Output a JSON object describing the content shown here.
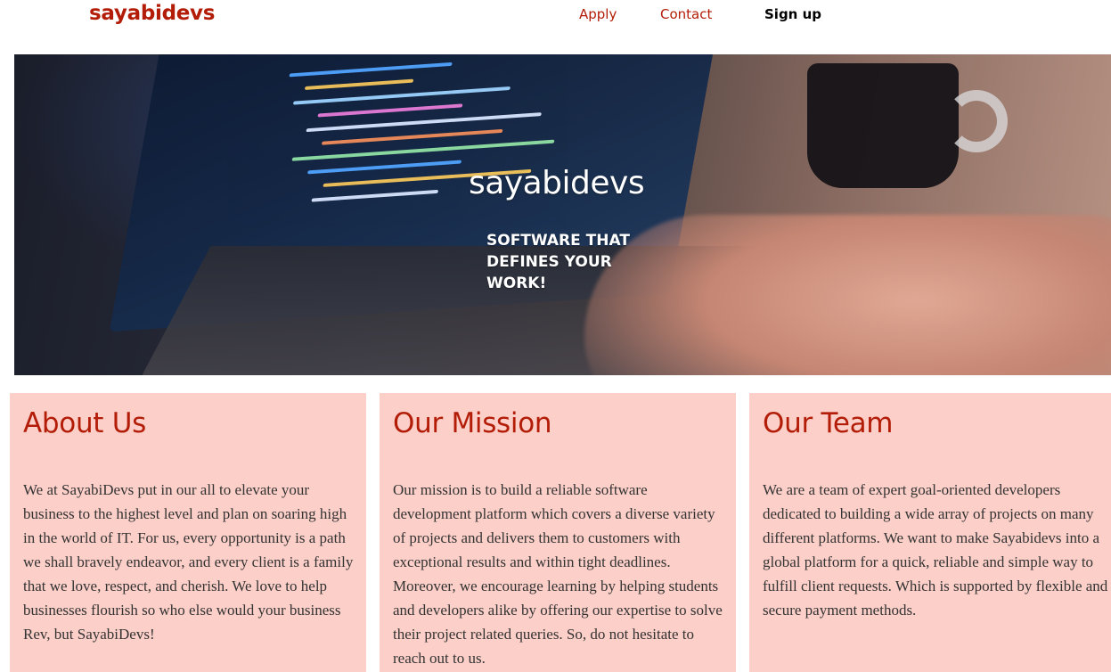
{
  "header": {
    "logo": "sayabidevs",
    "nav": {
      "apply": "Apply",
      "contact": "Contact",
      "signup": "Sign up"
    }
  },
  "hero": {
    "title": "sayabidevs",
    "tagline": "SOFTWARE THAT DEFINES YOUR WORK!",
    "image": "laptop-coding-photo"
  },
  "cards": [
    {
      "title": "About Us",
      "body": "We at SayabiDevs put in our all to elevate your business to the highest level and plan on soaring high in the world of IT. For us, every opportunity is a path we shall bravely endeavor, and every client is a family that we love, respect, and cherish. We love to help businesses flourish so who else would your business Rev, but SayabiDevs!"
    },
    {
      "title": "Our Mission",
      "body": "Our mission is to build a reliable software development platform which covers a diverse variety of projects and delivers them to customers with exceptional results and within tight deadlines. Moreover, we encourage learning by helping students and developers alike by offering our expertise to solve their project related queries. So, do not hesitate to reach out to us."
    },
    {
      "title": "Our Team",
      "body": "We are a team of expert goal-oriented developers dedicated to building a wide array of projects on many different platforms. We want to make Sayabidevs into a global platform for a quick, reliable and simple way to fulfill client requests. Which is supported by flexible and secure payment methods."
    }
  ],
  "colors": {
    "brand": "#b31d08",
    "card_background": "#fccfc8",
    "body_text": "#333333"
  }
}
